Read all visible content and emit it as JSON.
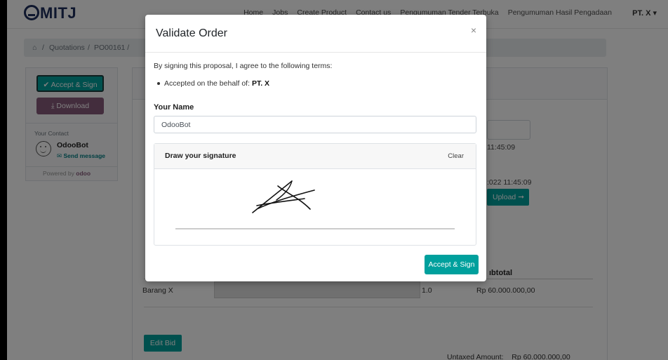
{
  "navbar": {
    "logo_text": "MITJ",
    "links": [
      "Home",
      "Jobs",
      "Create Product",
      "Contact us",
      "Pengumuman Tender Terbuka",
      "Pengumuman Hasil Pengadaan"
    ],
    "user": "PT. X ▾"
  },
  "breadcrumb": {
    "home_icon": "home-icon",
    "sep1": "/",
    "quotations": "Quotations",
    "sep2": "/",
    "current": "PO00161 /"
  },
  "sidebar": {
    "accept_sign_label": "✔ Accept & Sign",
    "download_label": "⤓ Download",
    "contact_title": "Your Contact",
    "contact_name": "OdooBot",
    "send_message": "✉ Send message",
    "powered_prefix": "Powered by ",
    "powered_brand": "odoo"
  },
  "background": {
    "date1": "11:45:09",
    "date2": ":022 11:45:09",
    "upload_label": "Upload ➞",
    "subtotal_header": "ıbtotal",
    "row": {
      "name": "Barang X",
      "qty": "1.0",
      "subtotal": "Rp 60.000.000,00"
    },
    "edit_bid": "Edit Bid",
    "untaxed_label": "Untaxed Amount:",
    "untaxed_value": "Rp 60.000.000,00"
  },
  "modal": {
    "title": "Validate Order",
    "close": "×",
    "terms_text": "By signing this proposal, I agree to the following terms:",
    "bullet_prefix": "Accepted on the behalf of: ",
    "bullet_company": "PT. X",
    "name_label": "Your Name",
    "name_value": "OdooBot",
    "signature_title": "Draw your signature",
    "clear_label": "Clear",
    "accept_label": "Accept & Sign"
  },
  "colors": {
    "primary": "#00A09D",
    "secondary": "#875A7B",
    "link": "#017e84"
  }
}
